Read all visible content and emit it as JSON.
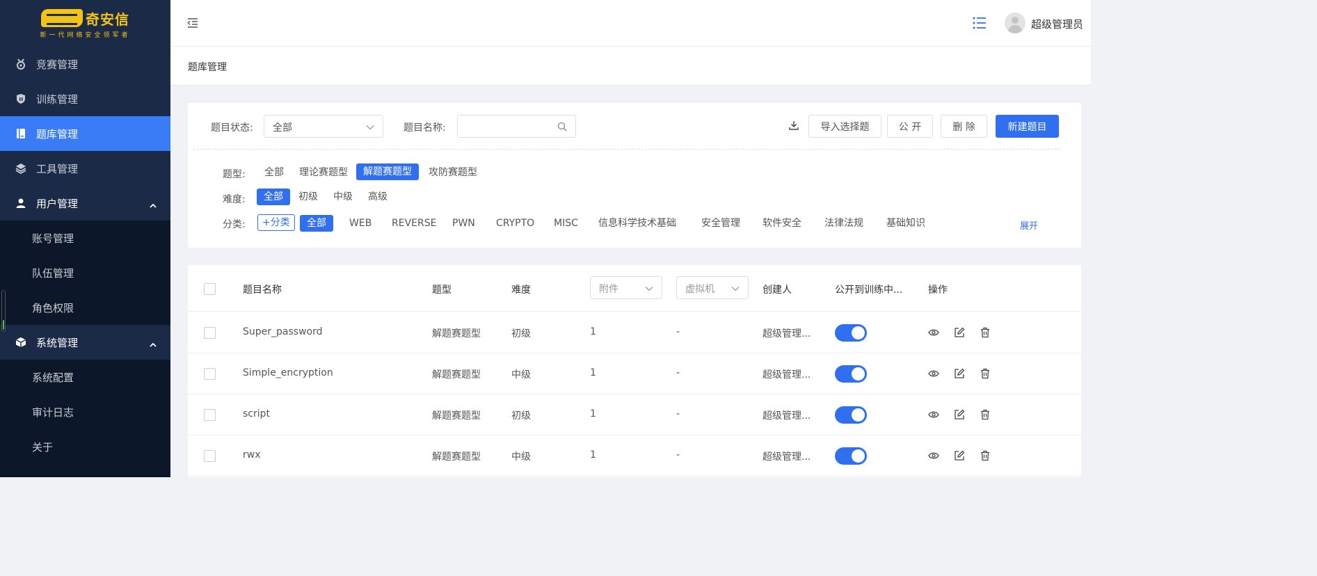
{
  "app": {
    "logo_text": "奇安信",
    "logo_slogan": "新一代网络安全领军者"
  },
  "sidebar": {
    "items": [
      {
        "label": "竞赛管理",
        "icon": "medal-icon"
      },
      {
        "label": "训练管理",
        "icon": "shield-icon"
      },
      {
        "label": "题库管理",
        "icon": "book-icon",
        "active": true
      },
      {
        "label": "工具管理",
        "icon": "layers-icon"
      },
      {
        "label": "用户管理",
        "icon": "user-icon",
        "expanded": true,
        "children": [
          "账号管理",
          "队伍管理",
          "角色权限"
        ]
      },
      {
        "label": "系统管理",
        "icon": "cube-icon",
        "expanded": true,
        "children": [
          "系统配置",
          "审计日志",
          "关于"
        ]
      }
    ]
  },
  "header": {
    "user_name": "超级管理员"
  },
  "breadcrumb": "题库管理",
  "filters": {
    "status_label": "题目状态:",
    "status_value": "全部",
    "name_label": "题目名称:",
    "name_placeholder": "",
    "import_btn": "导入选择题",
    "public_btn": "公 开",
    "delete_btn": "删 除",
    "new_btn": "新建题目",
    "type_label": "题型:",
    "types": [
      "全部",
      "理论赛题型",
      "解题赛题型",
      "攻防赛题型"
    ],
    "type_selected": "解题赛题型",
    "difficulty_label": "难度:",
    "difficulties": [
      "全部",
      "初级",
      "中级",
      "高级"
    ],
    "difficulty_selected": "全部",
    "category_label": "分类:",
    "add_category": "+分类",
    "categories": [
      "全部",
      "WEB",
      "REVERSE",
      "PWN",
      "CRYPTO",
      "MISC",
      "信息科学技术基础",
      "安全管理",
      "软件安全",
      "法律法规",
      "基础知识"
    ],
    "category_selected": "全部",
    "expand": "展开"
  },
  "table": {
    "headers": {
      "name": "题目名称",
      "type": "题型",
      "difficulty": "难度",
      "attachment": "附件",
      "vm": "虚拟机",
      "creator": "创建人",
      "public": "公开到训练中...",
      "actions": "操作"
    },
    "rows": [
      {
        "name": "Super_password",
        "type": "解题赛题型",
        "difficulty": "初级",
        "attachment": "1",
        "vm": "-",
        "creator": "超级管理...",
        "public": true
      },
      {
        "name": "Simple_encryption",
        "type": "解题赛题型",
        "difficulty": "中级",
        "attachment": "1",
        "vm": "-",
        "creator": "超级管理...",
        "public": true
      },
      {
        "name": "script",
        "type": "解题赛题型",
        "difficulty": "初级",
        "attachment": "1",
        "vm": "-",
        "creator": "超级管理...",
        "public": true
      },
      {
        "name": "rwx",
        "type": "解题赛题型",
        "difficulty": "中级",
        "attachment": "1",
        "vm": "-",
        "creator": "超级管理...",
        "public": true
      }
    ]
  },
  "colors": {
    "primary": "#2f6ff0",
    "sidebar_bg": "#0c1829",
    "sidebar_item_bg": "#1b2a47",
    "logo_yellow": "#f3c316"
  }
}
